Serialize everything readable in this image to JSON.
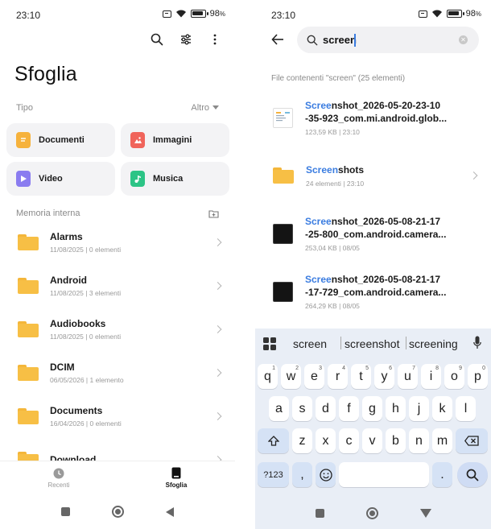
{
  "left": {
    "status": {
      "time": "23:10",
      "battery": "98",
      "battery_unit": "%"
    },
    "title": "Sfoglia",
    "tipo_label": "Tipo",
    "altro_label": "Altro",
    "categories": [
      {
        "label": "Documenti",
        "icon": "document-icon",
        "color": "#f6b23c"
      },
      {
        "label": "Immagini",
        "icon": "image-icon",
        "color": "#f0645b"
      },
      {
        "label": "Video",
        "icon": "video-icon",
        "color": "#8a7cf0"
      },
      {
        "label": "Musica",
        "icon": "music-icon",
        "color": "#2cc486"
      }
    ],
    "storage_label": "Memoria interna",
    "folders": [
      {
        "name": "Alarms",
        "date": "11/08/2025",
        "count": "0 elementi"
      },
      {
        "name": "Android",
        "date": "11/08/2025",
        "count": "3 elementi"
      },
      {
        "name": "Audiobooks",
        "date": "11/08/2025",
        "count": "0 elementi"
      },
      {
        "name": "DCIM",
        "date": "06/05/2026",
        "count": "1 elemento"
      },
      {
        "name": "Documents",
        "date": "16/04/2026",
        "count": "0 elementi"
      },
      {
        "name": "Download",
        "date": "",
        "count": ""
      }
    ],
    "tabs": [
      {
        "label": "Recenti"
      },
      {
        "label": "Sfoglia"
      }
    ]
  },
  "right": {
    "status": {
      "time": "23:10",
      "battery": "98",
      "battery_unit": "%"
    },
    "search_value": "screen",
    "results_header": "File contenenti \"screen\" (25 elementi)",
    "results": [
      {
        "match": "Scree",
        "rest1": "nshot_2026-05-20-23-10",
        "line2": "-35-923_com.mi.android.glob...",
        "size": "123,59 KB",
        "time": "23:10",
        "thumb": "doc"
      },
      {
        "match": "Screen",
        "rest1": "shots",
        "line2": "",
        "size": "24 elementi",
        "time": "23:10",
        "thumb": "folder"
      },
      {
        "match": "Scree",
        "rest1": "nshot_2026-05-08-21-17",
        "line2": "-25-800_com.android.camera...",
        "size": "253,04 KB",
        "time": "08/05",
        "thumb": "dark"
      },
      {
        "match": "Scree",
        "rest1": "nshot_2026-05-08-21-17",
        "line2": "-17-729_com.android.camera...",
        "size": "264,29 KB",
        "time": "08/05",
        "thumb": "dark"
      }
    ],
    "suggestions": [
      "screen",
      "screenshot",
      "screening"
    ],
    "keys_row1": [
      {
        "k": "q",
        "n": "1"
      },
      {
        "k": "w",
        "n": "2"
      },
      {
        "k": "e",
        "n": "3"
      },
      {
        "k": "r",
        "n": "4"
      },
      {
        "k": "t",
        "n": "5"
      },
      {
        "k": "y",
        "n": "6"
      },
      {
        "k": "u",
        "n": "7"
      },
      {
        "k": "i",
        "n": "8"
      },
      {
        "k": "o",
        "n": "9"
      },
      {
        "k": "p",
        "n": "0"
      }
    ],
    "keys_row2": [
      "a",
      "s",
      "d",
      "f",
      "g",
      "h",
      "j",
      "k",
      "l"
    ],
    "keys_row3": [
      "z",
      "x",
      "c",
      "v",
      "b",
      "n",
      "m"
    ],
    "key_symbols": "?123",
    "key_comma": ",",
    "key_period": "."
  }
}
